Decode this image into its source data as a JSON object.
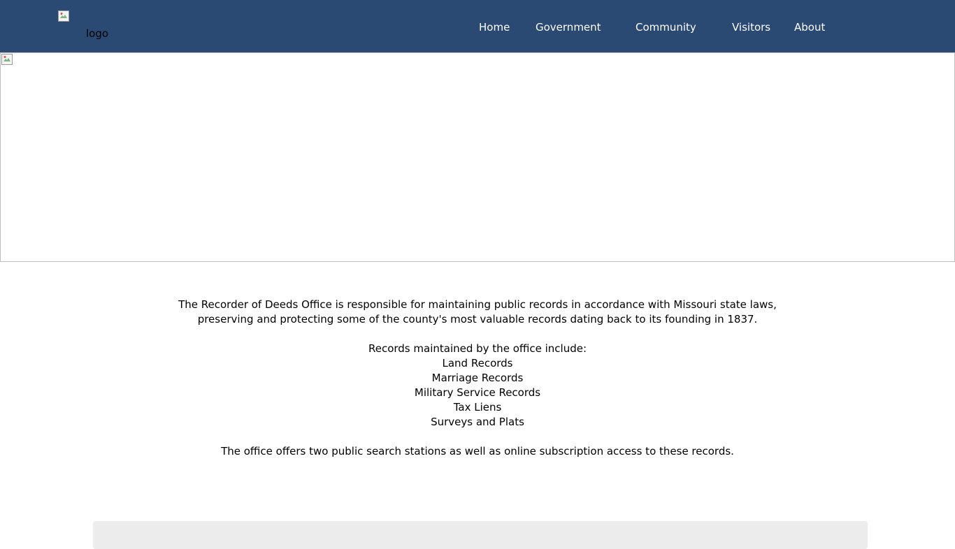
{
  "header": {
    "background": "#2a4a73",
    "logo_alt": "logo",
    "nav": [
      {
        "label": "Home"
      },
      {
        "label": "Government"
      },
      {
        "label": "Community"
      },
      {
        "label": "Visitors"
      },
      {
        "label": "About"
      }
    ]
  },
  "main": {
    "intro_line1": "The Recorder of Deeds Office is responsible for maintaining public records in accordance with Missouri state laws,",
    "intro_line2": "preserving and protecting some of the county's most valuable records dating back to its founding in 1837.",
    "records_heading": "Records maintained by the office include:",
    "records": [
      "Land Records",
      "Marriage Records",
      "Military Service Records",
      "Tax Liens",
      "Surveys and Plats"
    ],
    "closing": "The office offers two public search stations as well as online subscription access to these records."
  }
}
